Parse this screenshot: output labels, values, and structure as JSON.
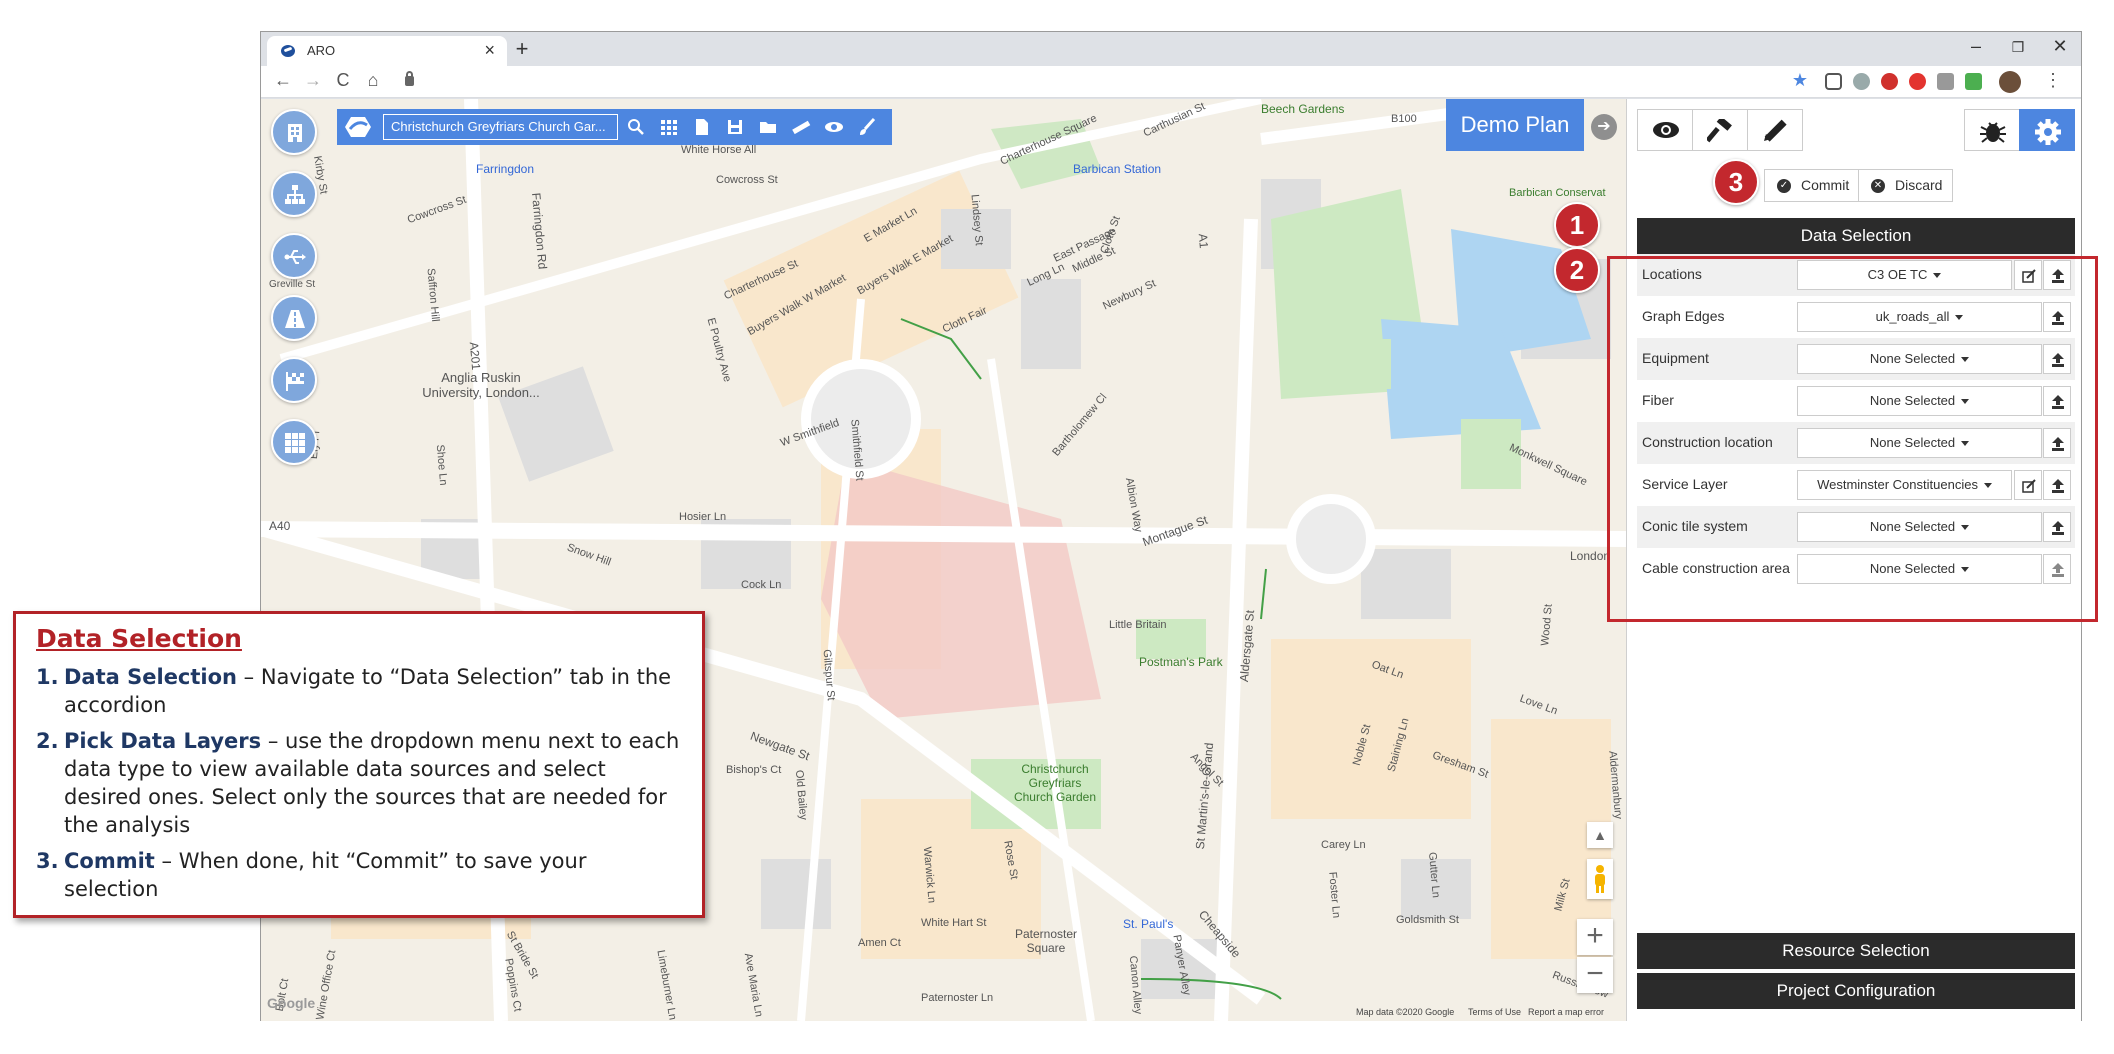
{
  "browser": {
    "tab_title": "ARO",
    "tab_close": "×",
    "new_tab": "+",
    "window_controls": [
      "–",
      "❐",
      "✕"
    ],
    "nav": [
      "←",
      "→",
      "C",
      "⌂"
    ]
  },
  "map_toolbar": {
    "search_value": "Christchurch Greyfriars Church Gar...",
    "icons": [
      "search-icon",
      "grid-icon",
      "document-icon",
      "save-icon",
      "folder-icon",
      "ruler-icon",
      "eye-icon",
      "brush-icon"
    ]
  },
  "map": {
    "plan_label": "Demo Plan",
    "zoom_in": "+",
    "zoom_out": "−",
    "footer_attribution": "Map data ©2020 Google",
    "footer_terms": "Terms of Use",
    "footer_report": "Report a map error",
    "google_logo": "Google",
    "labels": [
      {
        "text": "Farringdon"
      },
      {
        "text": "Barbican Station"
      },
      {
        "text": "Beech Gardens"
      },
      {
        "text": "B100"
      },
      {
        "text": "Barbican Conservat"
      },
      {
        "text": "Anglia Ruskin University, London..."
      },
      {
        "text": "Farringdon Rd"
      },
      {
        "text": "A201"
      },
      {
        "text": "A40"
      },
      {
        "text": "A1"
      },
      {
        "text": "Montague St"
      },
      {
        "text": "Little Britain"
      },
      {
        "text": "Postman's Park"
      },
      {
        "text": "Aldersgate St"
      },
      {
        "text": "Christchurch Greyfriars Church Garden"
      },
      {
        "text": "St Martin's-le-Grand"
      },
      {
        "text": "Paternoster Square"
      },
      {
        "text": "St. Paul's"
      },
      {
        "text": "Cheapside"
      },
      {
        "text": "Amen Ct"
      },
      {
        "text": "London"
      },
      {
        "text": "Monkwell Square"
      },
      {
        "text": "W Smithfield"
      },
      {
        "text": "Charterhouse St"
      },
      {
        "text": "Cowcross St"
      },
      {
        "text": "Long Ln"
      },
      {
        "text": "Hosier Ln"
      },
      {
        "text": "Cock Ln"
      },
      {
        "text": "Gresham St"
      },
      {
        "text": "Wood St"
      },
      {
        "text": "Foster Ln"
      },
      {
        "text": "Carey Ln"
      },
      {
        "text": "Goldsmith St"
      },
      {
        "text": "Russia Row"
      },
      {
        "text": "Snow Hill"
      },
      {
        "text": "Warwick Ln"
      },
      {
        "text": "Bishop's Ct"
      },
      {
        "text": "White Hart St"
      },
      {
        "text": "Paternoster Ln"
      },
      {
        "text": "Newgate St"
      },
      {
        "text": "Old Bailey"
      },
      {
        "text": "Giltspur St"
      },
      {
        "text": "Smithfield St"
      },
      {
        "text": "Cloth Fair"
      },
      {
        "text": "Lindsey St"
      },
      {
        "text": "Middle St"
      },
      {
        "text": "Cloth St"
      },
      {
        "text": "East Passage"
      },
      {
        "text": "Newbury St"
      },
      {
        "text": "Bartholomew Cl"
      },
      {
        "text": "Albion Way"
      },
      {
        "text": "Ely Pl"
      },
      {
        "text": "Saffron Hill"
      },
      {
        "text": "Greville St"
      },
      {
        "text": "Shoe Ln"
      },
      {
        "text": "St Bride St"
      },
      {
        "text": "Poppins Ct"
      },
      {
        "text": "Wine Office Ct"
      },
      {
        "text": "Bolt Ct"
      },
      {
        "text": "Limeburner Ln"
      },
      {
        "text": "Ave Maria Ln"
      },
      {
        "text": "Rose St"
      },
      {
        "text": "Panyer Alley"
      },
      {
        "text": "Canon Alley"
      },
      {
        "text": "Angel St"
      },
      {
        "text": "Noble St"
      },
      {
        "text": "Staining Ln"
      },
      {
        "text": "Gutter Ln"
      },
      {
        "text": "Milk St"
      },
      {
        "text": "Love Ln"
      },
      {
        "text": "Oat Ln"
      },
      {
        "text": "Aldermanbury"
      },
      {
        "text": "Carthusian St"
      },
      {
        "text": "Charterhouse Square"
      },
      {
        "text": "White Horse All"
      },
      {
        "text": "Kirby St"
      },
      {
        "text": "Cowcross St"
      },
      {
        "text": "Buyers Walk W Market"
      },
      {
        "text": "Buyers Walk E Market"
      },
      {
        "text": "E Market Ln"
      },
      {
        "text": "E Poultry Ave"
      }
    ]
  },
  "sidebar_buttons": [
    "building-icon",
    "network-icon",
    "usb-icon",
    "road-icon",
    "flag-icon",
    "grid-icon"
  ],
  "panel": {
    "top_buttons": [
      "eye-icon",
      "hammer-icon",
      "pencil-icon"
    ],
    "right_buttons": [
      "bug-icon",
      "gear-icon"
    ],
    "commit_label": "Commit",
    "discard_label": "Discard",
    "data_selection_header": "Data Selection",
    "rows": [
      {
        "label": "Locations",
        "value": "C3 OE TC",
        "edit": true
      },
      {
        "label": "Graph Edges",
        "value": "uk_roads_all",
        "edit": false
      },
      {
        "label": "Equipment",
        "value": "None Selected",
        "edit": false
      },
      {
        "label": "Fiber",
        "value": "None Selected",
        "edit": false
      },
      {
        "label": "Construction location",
        "value": "None Selected",
        "edit": false
      },
      {
        "label": "Service Layer",
        "value": "Westminster Constituencies",
        "edit": true
      },
      {
        "label": "Conic tile system",
        "value": "None Selected",
        "edit": false
      },
      {
        "label": "Cable construction area",
        "value": "None Selected",
        "edit": false
      }
    ],
    "resource_selection_header": "Resource Selection",
    "project_configuration_header": "Project Configuration"
  },
  "badges": [
    "1",
    "2",
    "3"
  ],
  "callout": {
    "title": "Data Selection",
    "items": [
      {
        "num": "1.",
        "key": "Data Selection",
        "text": " – Navigate to “Data Selection” tab in the accordion"
      },
      {
        "num": "2.",
        "key": "Pick Data Layers",
        "text": " – use the dropdown menu next to each data type to view available data sources and select desired ones. Select only the sources that are needed for the analysis"
      },
      {
        "num": "3.",
        "key": "Commit",
        "text": "  – When done, hit “Commit” to save your selection"
      }
    ]
  },
  "colors": {
    "accent_blue": "#4d86e0",
    "annotation_red": "#c3282e",
    "header_dark": "#2b2b2b"
  }
}
